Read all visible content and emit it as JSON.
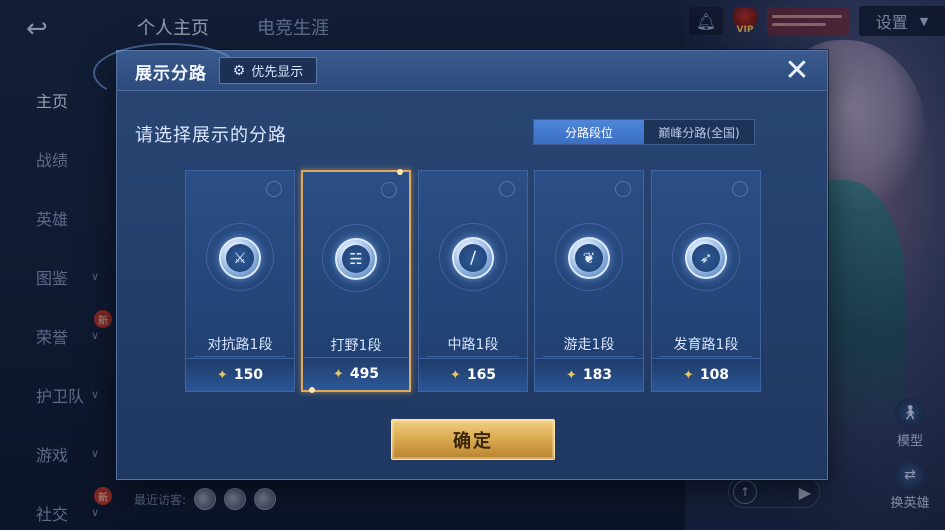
{
  "topbar": {
    "tabs": [
      {
        "label": "个人主页"
      },
      {
        "label": "电竞生涯"
      }
    ],
    "settings_label": "设置",
    "vip_label": "VIP"
  },
  "sidebar": {
    "items": [
      {
        "label": "主页",
        "active": true
      },
      {
        "label": "战绩"
      },
      {
        "label": "英雄"
      },
      {
        "label": "图鉴"
      },
      {
        "label": "荣誉",
        "badge": "新"
      },
      {
        "label": "护卫队"
      },
      {
        "label": "游戏"
      },
      {
        "label": "社交",
        "badge": "新"
      }
    ]
  },
  "footer": {
    "visitors_label": "最近访客:",
    "model_label": "模型",
    "change_hero_label": "换英雄"
  },
  "modal": {
    "title": "展示分路",
    "priority_button": "优先显示",
    "prompt": "请选择展示的分路",
    "toggle": {
      "options": [
        "分路段位",
        "巅峰分路(全国)"
      ],
      "selected": "分路段位"
    },
    "cards": [
      {
        "label": "对抗路1段",
        "points": "150",
        "icon": "sword-emblem-icon",
        "selected": false
      },
      {
        "label": "打野1段",
        "points": "495",
        "icon": "dragon-emblem-icon",
        "selected": true
      },
      {
        "label": "中路1段",
        "points": "165",
        "icon": "slash-emblem-icon",
        "selected": false
      },
      {
        "label": "游走1段",
        "points": "183",
        "icon": "wing-emblem-icon",
        "selected": false
      },
      {
        "label": "发育路1段",
        "points": "108",
        "icon": "bow-emblem-icon",
        "selected": false
      }
    ],
    "confirm_label": "确定",
    "close_icon": "close-icon"
  },
  "colors": {
    "accent_blue": "#3a6fc3",
    "selected_border": "#e0a85a",
    "confirm_gold": "#d9a94e",
    "points_icon": "#e8c46a"
  }
}
